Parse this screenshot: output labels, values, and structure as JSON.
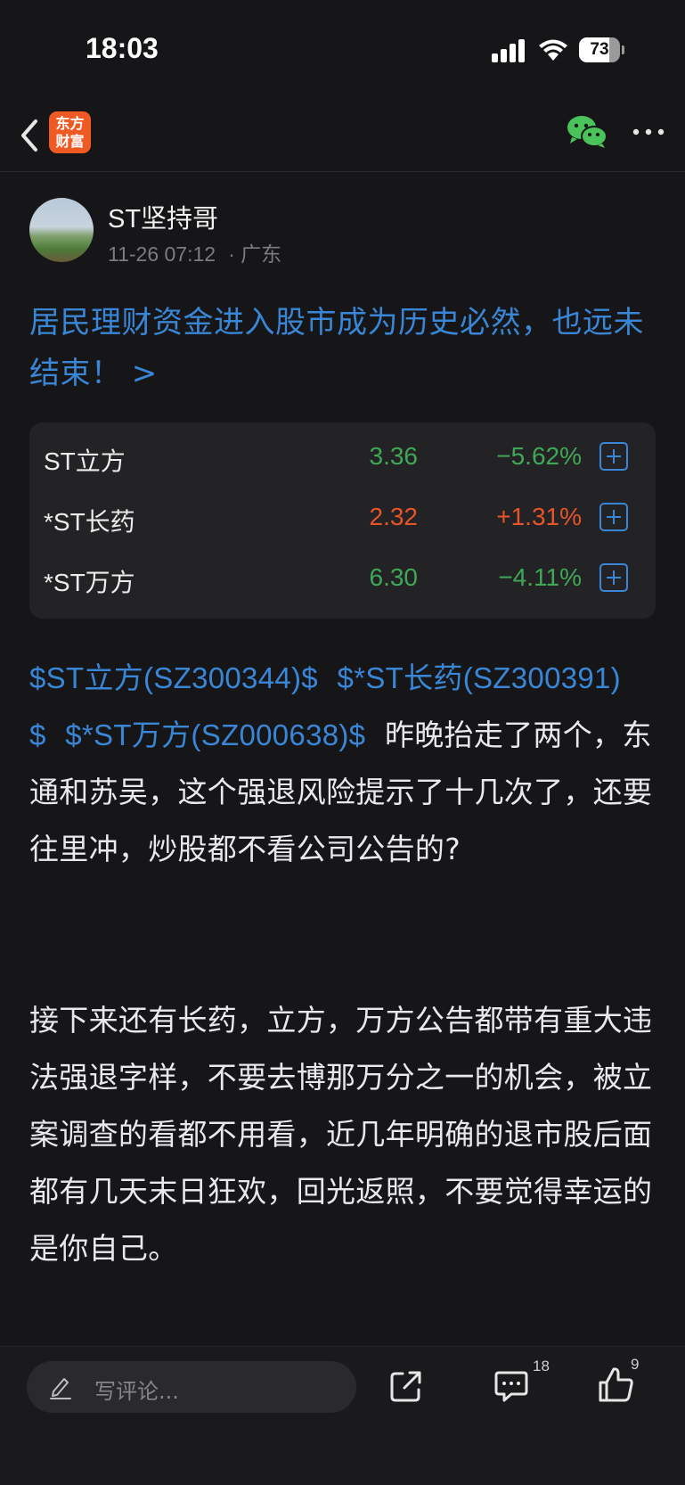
{
  "status_bar": {
    "time": "18:03",
    "battery": "73",
    "battery_level": 0.73
  },
  "nav": {
    "logo_line1": "东方",
    "logo_line2": "财富"
  },
  "author": {
    "name": "ST坚持哥",
    "date": "11-26 07:12",
    "location": "· 广东"
  },
  "topic": "居民理财资金进入股市成为历史必然，也远未结束！ >",
  "stocks": [
    {
      "name": "ST立方",
      "price": "3.36",
      "change": "−5.62%",
      "direction": "down"
    },
    {
      "name": "*ST长药",
      "price": "2.32",
      "change": "+1.31%",
      "direction": "up"
    },
    {
      "name": "*ST万方",
      "price": "6.30",
      "change": "−4.11%",
      "direction": "down"
    }
  ],
  "colors": {
    "accent": "#3a86d6",
    "down": "#3fa857",
    "up": "#e8542a",
    "background": "#161618"
  },
  "post": {
    "link1": "$ST立方(SZ300344)$",
    "link2": "$*ST长药(SZ300391)$",
    "link3": "$*ST万方(SZ000638)$",
    "text1": "昨晚抬走了两个，东通和苏吴，这个强退风险提示了十几次了，还要往里冲，炒股都不看公司公告的?",
    "text2": "接下来还有长药，立方，万方公告都带有重大违法强退字样，不要去博那万分之一的机会，被立案调查的看都不用看，近几年明确的退市股后面都有几天末日狂欢，回光返照，不要觉得幸运的是你自己。"
  },
  "bottom_bar": {
    "comment_placeholder": "写评论...",
    "comment_count": "18",
    "like_count": "9"
  }
}
